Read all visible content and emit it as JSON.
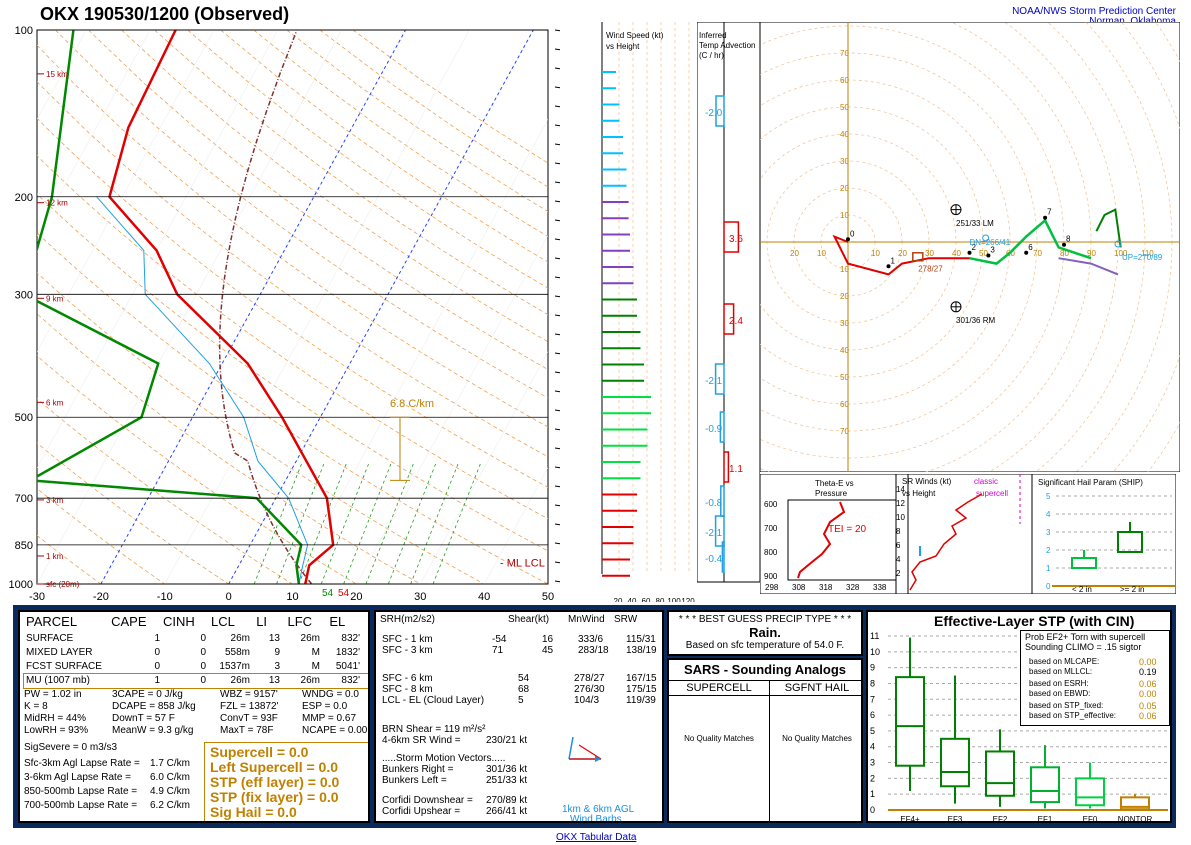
{
  "header": {
    "title": "OKX   190530/1200  (Observed)",
    "credit_line1": "NOAA/NWS Storm Prediction Center",
    "credit_line2": "Norman, Oklahoma",
    "footer_link": "OKX Tabular Data"
  },
  "skewt": {
    "pressure_levels": [
      "100",
      "200",
      "300",
      "500",
      "700",
      "850",
      "1000"
    ],
    "height_labels": [
      "15 km",
      "12 km",
      "9 km",
      "6 km",
      "3 km",
      "1 km",
      "sfc (20m)"
    ],
    "temp_ticks": [
      "-30",
      "-20",
      "-10",
      "0",
      "10",
      "20",
      "30",
      "40",
      "50"
    ],
    "lapse_label": "6.8 C/km",
    "lcl_label": "ML  LCL",
    "sfc_td": "54",
    "sfc_t": "54"
  },
  "wind_panel": {
    "title_l1": "Wind Speed (kt)",
    "title_l2": "vs Height",
    "axis": [
      "20",
      "40",
      "60",
      "80",
      "100",
      "120"
    ]
  },
  "adv_panel": {
    "title_l1": "Inferred",
    "title_l2": "Temp Advection",
    "title_l3": "(C / hr)",
    "values": [
      "-2.0",
      "3.6",
      "2.4",
      "-2.1",
      "-0.9",
      "1.1",
      "-0.8",
      "-2.1",
      "-0.4"
    ]
  },
  "hodograph": {
    "ring_labels": [
      "70",
      "60",
      "50",
      "40",
      "30",
      "20",
      "10",
      "10",
      "20",
      "30",
      "40",
      "50",
      "60",
      "70",
      "80",
      "90",
      "10",
      "20",
      "30",
      "40",
      "50",
      "60",
      "70",
      "80",
      "90",
      "100",
      "110"
    ],
    "lm_label": "251/33 LM",
    "rm_label": "301/36 RM",
    "mean_label": "278/27",
    "up_label": "UP=270/89",
    "dn_label": "DN=266/41",
    "points": [
      "0",
      "1",
      "2",
      "3",
      "6",
      "7",
      "8"
    ]
  },
  "theta_panel": {
    "title_l1": "Theta-E vs",
    "title_l2": "Pressure",
    "tei": "TEI = 20",
    "yticks": [
      "600",
      "700",
      "800",
      "900"
    ],
    "xticks": [
      "298",
      "308",
      "318",
      "328",
      "338"
    ]
  },
  "srw_panel": {
    "title_l1": "SR Winds (kt)",
    "title_l2": "vs Height",
    "classic": "classic",
    "supercell": "supercell",
    "yticks": [
      "14",
      "12",
      "10",
      "8",
      "6",
      "4",
      "2"
    ]
  },
  "ship_panel": {
    "title": "Significant Hail Param (SHIP)",
    "yticks": [
      "5",
      "4",
      "3",
      "2",
      "1",
      "0"
    ],
    "xl1": "< 2 in",
    "xl2": ">= 2 in"
  },
  "parcel_table": {
    "headers": [
      "PARCEL",
      "CAPE",
      "CINH",
      "LCL",
      "LI",
      "LFC",
      "EL"
    ],
    "rows": [
      [
        "SURFACE",
        "1",
        "0",
        "26m",
        "13",
        "26m",
        "832'"
      ],
      [
        "MIXED LAYER",
        "0",
        "0",
        "558m",
        "9",
        "M",
        "1832'"
      ],
      [
        "FCST SURFACE",
        "0",
        "0",
        "1537m",
        "3",
        "M",
        "5041'"
      ],
      [
        "MU   (1007 mb)",
        "1",
        "0",
        "26m",
        "13",
        "26m",
        "832'"
      ]
    ]
  },
  "indices": [
    [
      "PW = 1.02 in",
      "3CAPE = 0 J/kg",
      "WBZ = 9157'",
      "WNDG = 0.0"
    ],
    [
      "K = 8",
      "DCAPE = 858 J/kg",
      "FZL = 13872'",
      "ESP = 0.0"
    ],
    [
      "MidRH = 44%",
      "DownT = 57 F",
      "ConvT = 93F",
      "MMP = 0.67"
    ],
    [
      "LowRH = 93%",
      "MeanW = 9.3 g/kg",
      "MaxT = 78F",
      "NCAPE = 0.00"
    ]
  ],
  "sig_severe": "SigSevere = 0 m3/s3",
  "lapse_rates": [
    [
      "Sfc-3km Agl Lapse Rate =",
      "1.7 C/km"
    ],
    [
      "3-6km Agl Lapse Rate =",
      "6.0 C/km"
    ],
    [
      "850-500mb Lapse Rate =",
      "4.9 C/km"
    ],
    [
      "700-500mb Lapse Rate =",
      "6.2 C/km"
    ]
  ],
  "composite": [
    "Supercell = 0.0",
    "Left Supercell = 0.0",
    "STP (eff layer) = 0.0",
    "STP (fix layer) = 0.0",
    "Sig Hail = 0.0"
  ],
  "kinematics": {
    "headers": [
      "SRH(m2/s2)",
      "Shear(kt)",
      "MnWind",
      "SRW"
    ],
    "rows1": [
      [
        "SFC - 1 km",
        "-54",
        "16",
        "333/6",
        "115/31"
      ],
      [
        "SFC - 3 km",
        "71",
        "45",
        "283/18",
        "138/19"
      ]
    ],
    "rows2": [
      [
        "SFC - 6 km",
        "54",
        "278/27",
        "167/15"
      ],
      [
        "SFC - 8 km",
        "68",
        "276/30",
        "175/15"
      ],
      [
        "LCL - EL (Cloud Layer)",
        "5",
        "104/3",
        "119/39"
      ]
    ],
    "brn": "BRN Shear = 119 m²/s²",
    "sr46": "4-6km SR Wind =",
    "sr46v": "230/21 kt",
    "smv_title": ".....Storm Motion Vectors.....",
    "bunk_r": "Bunkers Right =",
    "bunk_r_v": "301/36 kt",
    "bunk_l": "Bunkers Left =",
    "bunk_l_v": "251/33 kt",
    "corf_d": "Corfidi Downshear =",
    "corf_d_v": "270/89 kt",
    "corf_u": "Corfidi Upshear =",
    "corf_u_v": "266/41 kt",
    "barb_l1": "1km & 6km AGL",
    "barb_l2": "Wind Barbs"
  },
  "precip": {
    "title": "* * * BEST GUESS PRECIP TYPE * * *",
    "value": "Rain.",
    "note": "Based on sfc temperature of 54.0 F."
  },
  "sars": {
    "title": "SARS - Sounding Analogs",
    "col1": "SUPERCELL",
    "col2": "SGFNT HAIL",
    "nm1": "No Quality Matches",
    "nm2": "No Quality Matches"
  },
  "stp": {
    "title": "Effective-Layer STP (with CIN)",
    "prob_l1": "Prob EF2+ Torn with supercell",
    "prob_l2": "Sounding CLIMO = .15 sigtor",
    "rows": [
      [
        "based on MLCAPE:",
        "0.00"
      ],
      [
        "based on MLLCL:",
        "0.19"
      ],
      [
        "based on ESRH:",
        "0.06"
      ],
      [
        "based on EBWD:",
        "0.00"
      ],
      [
        "based on STP_fixed:",
        "0.05"
      ],
      [
        "based on STP_effective:",
        "0.06"
      ]
    ],
    "yticks": [
      "11",
      "10",
      "9",
      "8",
      "7",
      "6",
      "5",
      "4",
      "3",
      "2",
      "1",
      "0"
    ],
    "cats": [
      "EF4+",
      "EF3",
      "EF2",
      "EF1",
      "EF0",
      "NONTOR"
    ]
  },
  "chart_data": {
    "type": "line",
    "title": "OKX 190530/1200 (Observed)",
    "xlabel": "",
    "ylabel": "",
    "x_range": [
      -30,
      50
    ],
    "y_range_mb": [
      1000,
      100
    ],
    "series": [
      {
        "name": "Temperature",
        "color": "#e00000",
        "values_mb_C": [
          [
            1000,
            12
          ],
          [
            925,
            11
          ],
          [
            850,
            13
          ],
          [
            700,
            8
          ],
          [
            500,
            -6
          ],
          [
            400,
            -16
          ],
          [
            300,
            -33
          ],
          [
            250,
            -40
          ],
          [
            200,
            -52
          ],
          [
            150,
            -55
          ],
          [
            100,
            -56
          ]
        ]
      },
      {
        "name": "Dewpoint",
        "color": "#008800",
        "values_mb_C": [
          [
            1000,
            11
          ],
          [
            925,
            9
          ],
          [
            850,
            8
          ],
          [
            700,
            -3
          ],
          [
            650,
            -40
          ],
          [
            500,
            -28
          ],
          [
            400,
            -30
          ],
          [
            300,
            -57
          ],
          [
            200,
            -61
          ],
          [
            100,
            -72
          ]
        ]
      }
    ],
    "wind_speed_profile_kt": [
      20,
      25,
      30,
      35,
      38,
      40,
      45,
      50,
      55,
      60,
      70,
      65,
      55,
      50,
      45,
      40
    ],
    "hodograph_points": [
      [
        0,
        0
      ],
      [
        1,
        null
      ],
      [
        2,
        null
      ],
      [
        3,
        null
      ],
      [
        6,
        null
      ],
      [
        7,
        null
      ],
      [
        8,
        null
      ]
    ]
  }
}
